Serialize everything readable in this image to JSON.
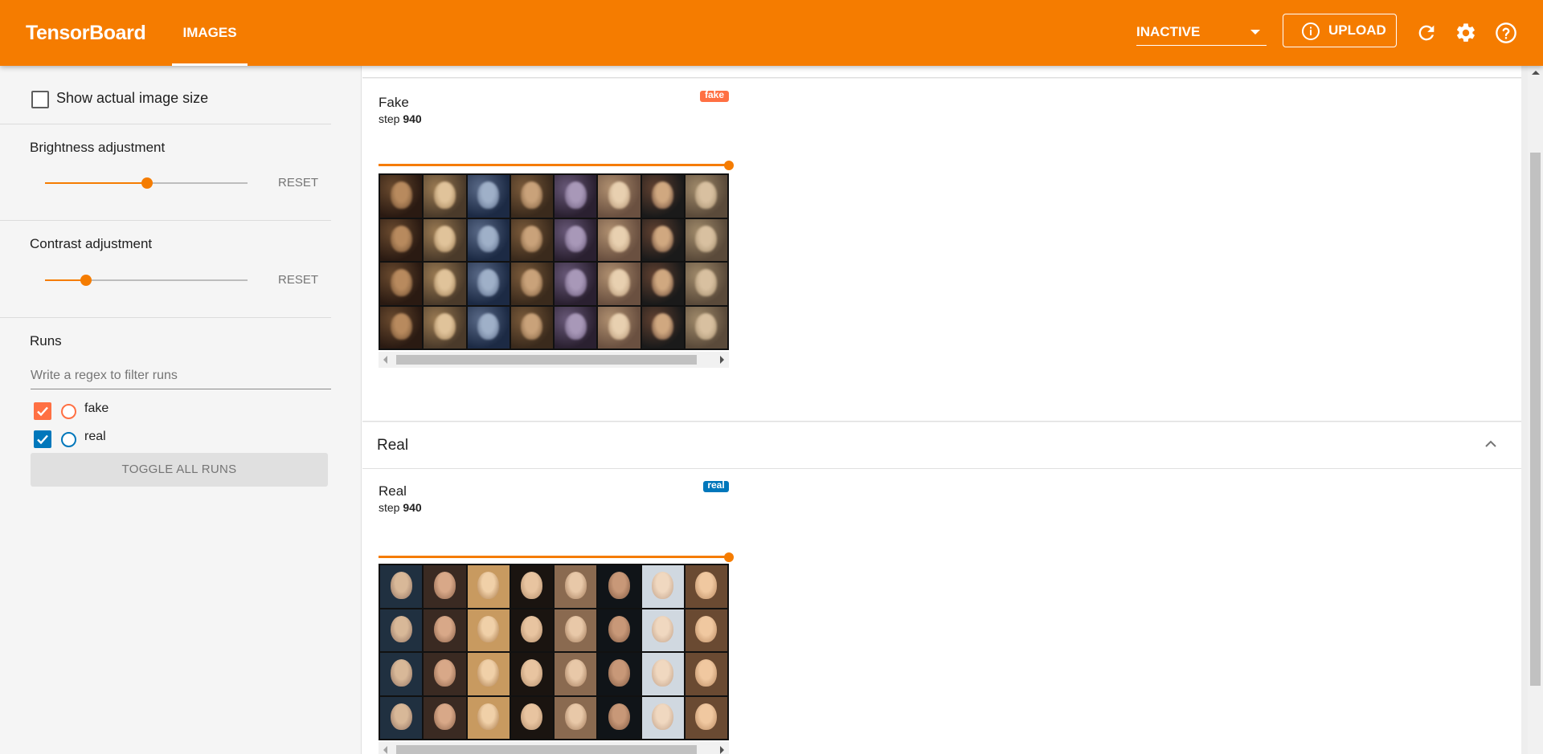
{
  "header": {
    "brand": "TensorBoard",
    "tab_label": "IMAGES",
    "reload_status": "INACTIVE",
    "upload_label": "UPLOAD",
    "icons": [
      "info-icon",
      "refresh-icon",
      "settings-icon",
      "help-icon"
    ]
  },
  "sidebar": {
    "show_actual_size_label": "Show actual image size",
    "show_actual_size_checked": false,
    "brightness": {
      "label": "Brightness adjustment",
      "reset_label": "RESET",
      "level": 0.5
    },
    "contrast": {
      "label": "Contrast adjustment",
      "reset_label": "RESET",
      "level": 0.2
    },
    "runs": {
      "title": "Runs",
      "filter_placeholder": "Write a regex to filter runs",
      "items": [
        {
          "label": "fake",
          "checked": true,
          "color": "#ff7043"
        },
        {
          "label": "real",
          "checked": true,
          "color": "#0077bb"
        }
      ],
      "toggle_all_label": "TOGGLE ALL RUNS"
    }
  },
  "main": {
    "fake_card": {
      "title": "Fake",
      "step_label": "step",
      "step_value": "940",
      "run_tag": "fake",
      "tag_color": "#ff7043"
    },
    "real_section": {
      "header_title": "Real"
    },
    "real_card": {
      "title": "Real",
      "step_label": "step",
      "step_value": "940",
      "run_tag": "real",
      "tag_color": "#0077bb"
    }
  },
  "colors": {
    "accent": "#f57c00",
    "sidebar_bg": "#f5f5f5"
  }
}
